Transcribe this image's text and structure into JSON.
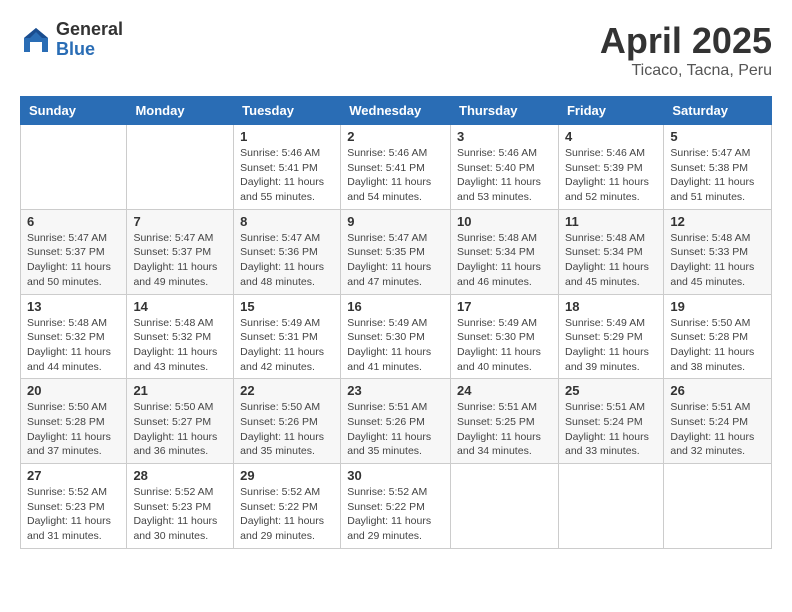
{
  "header": {
    "logo_general": "General",
    "logo_blue": "Blue",
    "month_year": "April 2025",
    "location": "Ticaco, Tacna, Peru"
  },
  "calendar": {
    "days_of_week": [
      "Sunday",
      "Monday",
      "Tuesday",
      "Wednesday",
      "Thursday",
      "Friday",
      "Saturday"
    ],
    "weeks": [
      [
        {
          "day": "",
          "info": ""
        },
        {
          "day": "",
          "info": ""
        },
        {
          "day": "1",
          "info": "Sunrise: 5:46 AM\nSunset: 5:41 PM\nDaylight: 11 hours and 55 minutes."
        },
        {
          "day": "2",
          "info": "Sunrise: 5:46 AM\nSunset: 5:41 PM\nDaylight: 11 hours and 54 minutes."
        },
        {
          "day": "3",
          "info": "Sunrise: 5:46 AM\nSunset: 5:40 PM\nDaylight: 11 hours and 53 minutes."
        },
        {
          "day": "4",
          "info": "Sunrise: 5:46 AM\nSunset: 5:39 PM\nDaylight: 11 hours and 52 minutes."
        },
        {
          "day": "5",
          "info": "Sunrise: 5:47 AM\nSunset: 5:38 PM\nDaylight: 11 hours and 51 minutes."
        }
      ],
      [
        {
          "day": "6",
          "info": "Sunrise: 5:47 AM\nSunset: 5:37 PM\nDaylight: 11 hours and 50 minutes."
        },
        {
          "day": "7",
          "info": "Sunrise: 5:47 AM\nSunset: 5:37 PM\nDaylight: 11 hours and 49 minutes."
        },
        {
          "day": "8",
          "info": "Sunrise: 5:47 AM\nSunset: 5:36 PM\nDaylight: 11 hours and 48 minutes."
        },
        {
          "day": "9",
          "info": "Sunrise: 5:47 AM\nSunset: 5:35 PM\nDaylight: 11 hours and 47 minutes."
        },
        {
          "day": "10",
          "info": "Sunrise: 5:48 AM\nSunset: 5:34 PM\nDaylight: 11 hours and 46 minutes."
        },
        {
          "day": "11",
          "info": "Sunrise: 5:48 AM\nSunset: 5:34 PM\nDaylight: 11 hours and 45 minutes."
        },
        {
          "day": "12",
          "info": "Sunrise: 5:48 AM\nSunset: 5:33 PM\nDaylight: 11 hours and 45 minutes."
        }
      ],
      [
        {
          "day": "13",
          "info": "Sunrise: 5:48 AM\nSunset: 5:32 PM\nDaylight: 11 hours and 44 minutes."
        },
        {
          "day": "14",
          "info": "Sunrise: 5:48 AM\nSunset: 5:32 PM\nDaylight: 11 hours and 43 minutes."
        },
        {
          "day": "15",
          "info": "Sunrise: 5:49 AM\nSunset: 5:31 PM\nDaylight: 11 hours and 42 minutes."
        },
        {
          "day": "16",
          "info": "Sunrise: 5:49 AM\nSunset: 5:30 PM\nDaylight: 11 hours and 41 minutes."
        },
        {
          "day": "17",
          "info": "Sunrise: 5:49 AM\nSunset: 5:30 PM\nDaylight: 11 hours and 40 minutes."
        },
        {
          "day": "18",
          "info": "Sunrise: 5:49 AM\nSunset: 5:29 PM\nDaylight: 11 hours and 39 minutes."
        },
        {
          "day": "19",
          "info": "Sunrise: 5:50 AM\nSunset: 5:28 PM\nDaylight: 11 hours and 38 minutes."
        }
      ],
      [
        {
          "day": "20",
          "info": "Sunrise: 5:50 AM\nSunset: 5:28 PM\nDaylight: 11 hours and 37 minutes."
        },
        {
          "day": "21",
          "info": "Sunrise: 5:50 AM\nSunset: 5:27 PM\nDaylight: 11 hours and 36 minutes."
        },
        {
          "day": "22",
          "info": "Sunrise: 5:50 AM\nSunset: 5:26 PM\nDaylight: 11 hours and 35 minutes."
        },
        {
          "day": "23",
          "info": "Sunrise: 5:51 AM\nSunset: 5:26 PM\nDaylight: 11 hours and 35 minutes."
        },
        {
          "day": "24",
          "info": "Sunrise: 5:51 AM\nSunset: 5:25 PM\nDaylight: 11 hours and 34 minutes."
        },
        {
          "day": "25",
          "info": "Sunrise: 5:51 AM\nSunset: 5:24 PM\nDaylight: 11 hours and 33 minutes."
        },
        {
          "day": "26",
          "info": "Sunrise: 5:51 AM\nSunset: 5:24 PM\nDaylight: 11 hours and 32 minutes."
        }
      ],
      [
        {
          "day": "27",
          "info": "Sunrise: 5:52 AM\nSunset: 5:23 PM\nDaylight: 11 hours and 31 minutes."
        },
        {
          "day": "28",
          "info": "Sunrise: 5:52 AM\nSunset: 5:23 PM\nDaylight: 11 hours and 30 minutes."
        },
        {
          "day": "29",
          "info": "Sunrise: 5:52 AM\nSunset: 5:22 PM\nDaylight: 11 hours and 29 minutes."
        },
        {
          "day": "30",
          "info": "Sunrise: 5:52 AM\nSunset: 5:22 PM\nDaylight: 11 hours and 29 minutes."
        },
        {
          "day": "",
          "info": ""
        },
        {
          "day": "",
          "info": ""
        },
        {
          "day": "",
          "info": ""
        }
      ]
    ]
  }
}
